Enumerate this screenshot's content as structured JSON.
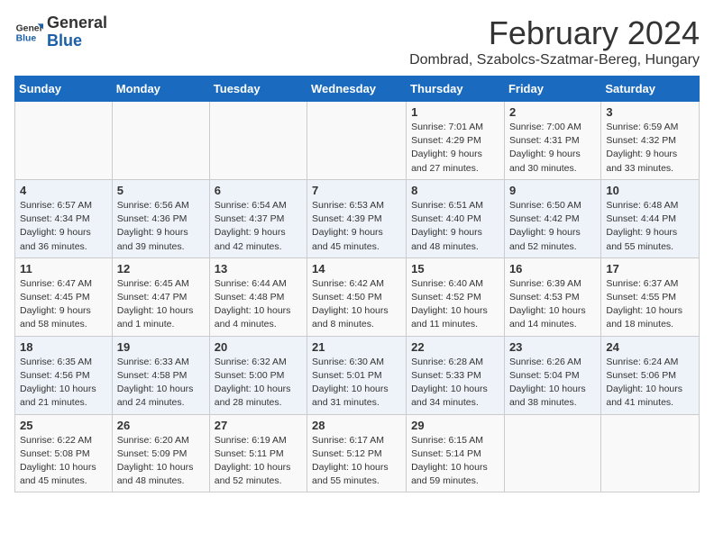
{
  "logo": {
    "text_general": "General",
    "text_blue": "Blue"
  },
  "header": {
    "month_year": "February 2024",
    "location": "Dombrad, Szabolcs-Szatmar-Bereg, Hungary"
  },
  "weekdays": [
    "Sunday",
    "Monday",
    "Tuesday",
    "Wednesday",
    "Thursday",
    "Friday",
    "Saturday"
  ],
  "weeks": [
    [
      {
        "day": "",
        "info": ""
      },
      {
        "day": "",
        "info": ""
      },
      {
        "day": "",
        "info": ""
      },
      {
        "day": "",
        "info": ""
      },
      {
        "day": "1",
        "info": "Sunrise: 7:01 AM\nSunset: 4:29 PM\nDaylight: 9 hours and 27 minutes."
      },
      {
        "day": "2",
        "info": "Sunrise: 7:00 AM\nSunset: 4:31 PM\nDaylight: 9 hours and 30 minutes."
      },
      {
        "day": "3",
        "info": "Sunrise: 6:59 AM\nSunset: 4:32 PM\nDaylight: 9 hours and 33 minutes."
      }
    ],
    [
      {
        "day": "4",
        "info": "Sunrise: 6:57 AM\nSunset: 4:34 PM\nDaylight: 9 hours and 36 minutes."
      },
      {
        "day": "5",
        "info": "Sunrise: 6:56 AM\nSunset: 4:36 PM\nDaylight: 9 hours and 39 minutes."
      },
      {
        "day": "6",
        "info": "Sunrise: 6:54 AM\nSunset: 4:37 PM\nDaylight: 9 hours and 42 minutes."
      },
      {
        "day": "7",
        "info": "Sunrise: 6:53 AM\nSunset: 4:39 PM\nDaylight: 9 hours and 45 minutes."
      },
      {
        "day": "8",
        "info": "Sunrise: 6:51 AM\nSunset: 4:40 PM\nDaylight: 9 hours and 48 minutes."
      },
      {
        "day": "9",
        "info": "Sunrise: 6:50 AM\nSunset: 4:42 PM\nDaylight: 9 hours and 52 minutes."
      },
      {
        "day": "10",
        "info": "Sunrise: 6:48 AM\nSunset: 4:44 PM\nDaylight: 9 hours and 55 minutes."
      }
    ],
    [
      {
        "day": "11",
        "info": "Sunrise: 6:47 AM\nSunset: 4:45 PM\nDaylight: 9 hours and 58 minutes."
      },
      {
        "day": "12",
        "info": "Sunrise: 6:45 AM\nSunset: 4:47 PM\nDaylight: 10 hours and 1 minute."
      },
      {
        "day": "13",
        "info": "Sunrise: 6:44 AM\nSunset: 4:48 PM\nDaylight: 10 hours and 4 minutes."
      },
      {
        "day": "14",
        "info": "Sunrise: 6:42 AM\nSunset: 4:50 PM\nDaylight: 10 hours and 8 minutes."
      },
      {
        "day": "15",
        "info": "Sunrise: 6:40 AM\nSunset: 4:52 PM\nDaylight: 10 hours and 11 minutes."
      },
      {
        "day": "16",
        "info": "Sunrise: 6:39 AM\nSunset: 4:53 PM\nDaylight: 10 hours and 14 minutes."
      },
      {
        "day": "17",
        "info": "Sunrise: 6:37 AM\nSunset: 4:55 PM\nDaylight: 10 hours and 18 minutes."
      }
    ],
    [
      {
        "day": "18",
        "info": "Sunrise: 6:35 AM\nSunset: 4:56 PM\nDaylight: 10 hours and 21 minutes."
      },
      {
        "day": "19",
        "info": "Sunrise: 6:33 AM\nSunset: 4:58 PM\nDaylight: 10 hours and 24 minutes."
      },
      {
        "day": "20",
        "info": "Sunrise: 6:32 AM\nSunset: 5:00 PM\nDaylight: 10 hours and 28 minutes."
      },
      {
        "day": "21",
        "info": "Sunrise: 6:30 AM\nSunset: 5:01 PM\nDaylight: 10 hours and 31 minutes."
      },
      {
        "day": "22",
        "info": "Sunrise: 6:28 AM\nSunset: 5:33 PM\nDaylight: 10 hours and 34 minutes."
      },
      {
        "day": "23",
        "info": "Sunrise: 6:26 AM\nSunset: 5:04 PM\nDaylight: 10 hours and 38 minutes."
      },
      {
        "day": "24",
        "info": "Sunrise: 6:24 AM\nSunset: 5:06 PM\nDaylight: 10 hours and 41 minutes."
      }
    ],
    [
      {
        "day": "25",
        "info": "Sunrise: 6:22 AM\nSunset: 5:08 PM\nDaylight: 10 hours and 45 minutes."
      },
      {
        "day": "26",
        "info": "Sunrise: 6:20 AM\nSunset: 5:09 PM\nDaylight: 10 hours and 48 minutes."
      },
      {
        "day": "27",
        "info": "Sunrise: 6:19 AM\nSunset: 5:11 PM\nDaylight: 10 hours and 52 minutes."
      },
      {
        "day": "28",
        "info": "Sunrise: 6:17 AM\nSunset: 5:12 PM\nDaylight: 10 hours and 55 minutes."
      },
      {
        "day": "29",
        "info": "Sunrise: 6:15 AM\nSunset: 5:14 PM\nDaylight: 10 hours and 59 minutes."
      },
      {
        "day": "",
        "info": ""
      },
      {
        "day": "",
        "info": ""
      }
    ]
  ]
}
